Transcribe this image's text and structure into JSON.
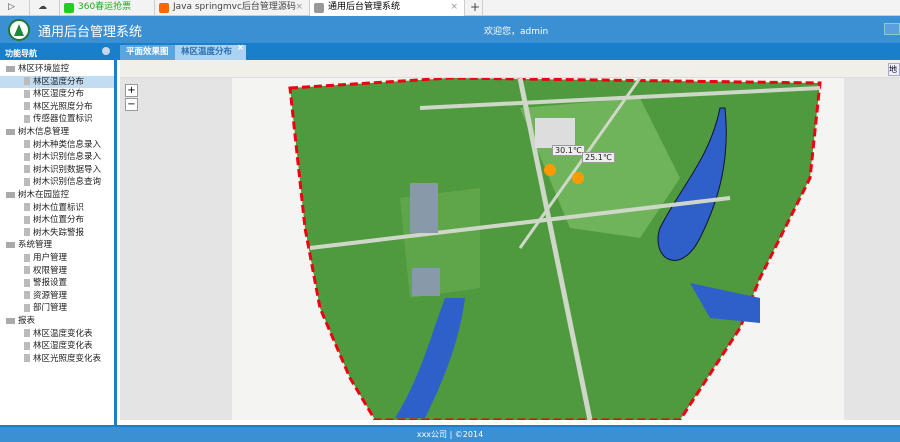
{
  "browser": {
    "tabs": [
      {
        "label": "360春运抢票"
      },
      {
        "label": "Java springmvc后台管理源码"
      },
      {
        "label": "通用后台管理系统"
      }
    ],
    "new_tab": "+"
  },
  "header": {
    "title": "通用后台管理系统",
    "welcome": "欢迎您，admin"
  },
  "sidebar": {
    "title": "功能导航",
    "tree": [
      {
        "label": "林区环境监控",
        "children": [
          "林区温度分布",
          "林区湿度分布",
          "林区光照度分布",
          "传感器位置标识"
        ]
      },
      {
        "label": "树木信息管理",
        "children": [
          "树木种类信息录入",
          "树木识别信息录入",
          "树木识别数据导入",
          "树木识别信息查询"
        ]
      },
      {
        "label": "树木在园监控",
        "children": [
          "树木位置标识",
          "树木位置分布",
          "树木失踪警报"
        ]
      },
      {
        "label": "系统管理",
        "children": [
          "用户管理",
          "权限管理",
          "警报设置",
          "资源管理",
          "部门管理"
        ]
      },
      {
        "label": "报表",
        "children": [
          "林区温度变化表",
          "林区湿度变化表",
          "林区光照度变化表"
        ]
      }
    ],
    "selected": "林区温度分布"
  },
  "tabs": [
    {
      "label": "平面效果图"
    },
    {
      "label": "林区温度分布",
      "close": "×"
    }
  ],
  "toolbar": {
    "button": "地"
  },
  "map": {
    "zoom_in": "+",
    "zoom_out": "−",
    "sensors": [
      {
        "temp": "30.1℃"
      },
      {
        "temp": "25.1℃"
      }
    ]
  },
  "footer": {
    "text": "xxx公司 | ©2014"
  },
  "colors": {
    "header": "#3b90d3",
    "band": "#1a7fca",
    "selected": "#c2dcf2"
  }
}
